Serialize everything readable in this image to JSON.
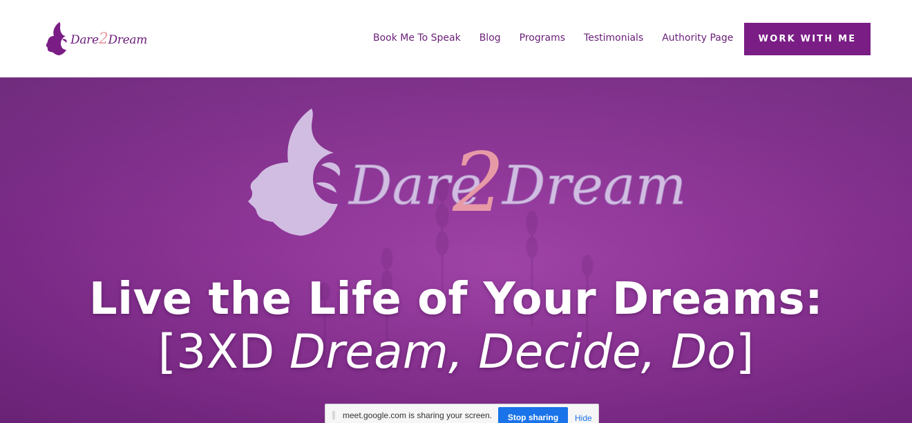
{
  "header": {
    "logo": {
      "part1": "Dare",
      "part2": "2",
      "part3": "Dream"
    },
    "nav": [
      {
        "label": "Book Me To Speak"
      },
      {
        "label": "Blog"
      },
      {
        "label": "Programs"
      },
      {
        "label": "Testimonials"
      },
      {
        "label": "Authority Page"
      }
    ],
    "cta_label": "WORK WITH ME"
  },
  "hero": {
    "logo": {
      "part1": "Dare",
      "part2": "2",
      "part3": "Dream"
    },
    "headline_line1": "Live the Life of Your Dreams:",
    "headline_line2_prefix": "[3XD ",
    "headline_line2_italic": "Dream, Decide, Do",
    "headline_line2_suffix": "]"
  },
  "share_bar": {
    "message": "meet.google.com is sharing your screen.",
    "stop_label": "Stop sharing",
    "hide_label": "Hide"
  },
  "colors": {
    "brand_purple": "#7a1d85",
    "nav_text": "#6a2078",
    "logo_pink": "#e79aa6",
    "hero_logo_lilac": "#d2bde2",
    "share_button_blue": "#1a73e8"
  }
}
